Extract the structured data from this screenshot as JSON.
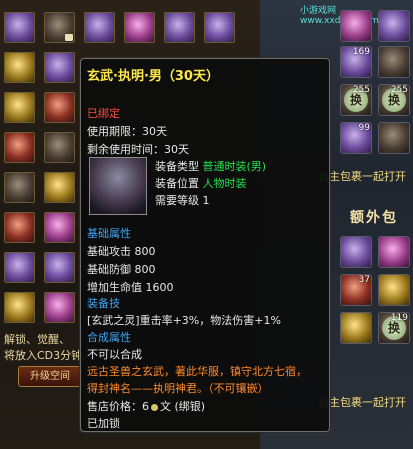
{
  "left_panel": {
    "line1": "解锁、觉醒、",
    "line2": "将放入CD3分钟。",
    "upgrade_button": "升级空间"
  },
  "right_panel": {
    "watermark": "小游戏网 www.xxds77.com",
    "row_text_1": "自主包裹一起打开",
    "row_text_2": "自主包裹一起打开",
    "section_title": "额外包",
    "counts": [
      "169",
      "255",
      "255",
      "99",
      "37",
      "119"
    ],
    "exchange_glyph": "换"
  },
  "tooltip": {
    "title": "玄武·执明·男（30天）",
    "bound": "已绑定",
    "period": "使用期限：30天",
    "remaining": "剩余使用时间：30天",
    "equip_type_label": "装备类型",
    "equip_type_value": "普通时装(男)",
    "equip_slot_label": "装备位置",
    "equip_slot_value": "人物时装",
    "level_label": "需要等级",
    "level_value": "1",
    "base_attr_header": "基础属性",
    "atk": "基础攻击 800",
    "def": "基础防御 800",
    "hp": "增加生命值 1600",
    "skill_header": "装备技",
    "skill_desc": "[玄武之灵]重击率+3%，物法伤害+1%",
    "combine_header": "合成属性",
    "no_combine": "不可以合成",
    "lore_1": "远古圣兽之玄武，著此华服，镇守北方七宿，",
    "lore_2": "得封神名——执明神君。（不可镶嵌）",
    "price_label": "售店价格：",
    "price_value": "6",
    "price_unit": "文",
    "price_note": "(绑银)",
    "locked": "已加锁"
  },
  "colors": {
    "title": "#ffe84a",
    "red": "#ff4a3a",
    "green": "#24e04a",
    "blue": "#3fa4f2",
    "orange": "#ff8a2a"
  }
}
